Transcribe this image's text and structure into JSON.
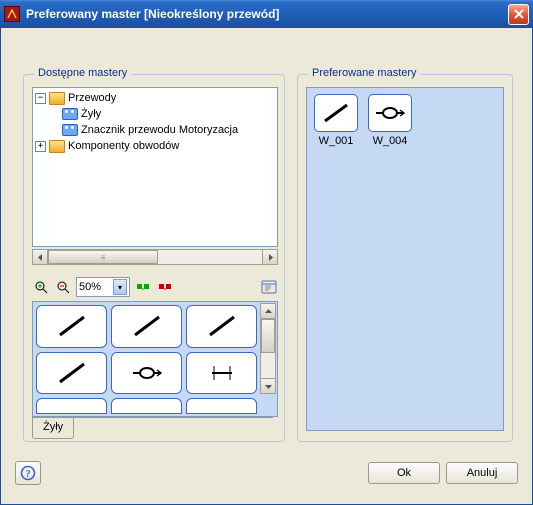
{
  "window": {
    "title": "Preferowany master [Nieokreślony przewód]"
  },
  "left_group": {
    "legend": "Dostępne mastery"
  },
  "right_group": {
    "legend": "Preferowane mastery"
  },
  "tree": {
    "root": "Przewody",
    "children": [
      "Żyły",
      "Znacznik przewodu Motoryzacja"
    ],
    "sibling": "Komponenty obwodów"
  },
  "zoom": {
    "value": "50%"
  },
  "grid_tab": {
    "label": "Żyły"
  },
  "preferred": {
    "items": [
      {
        "label": "W_001"
      },
      {
        "label": "W_004"
      }
    ]
  },
  "buttons": {
    "ok": "Ok",
    "cancel": "Anuluj"
  }
}
